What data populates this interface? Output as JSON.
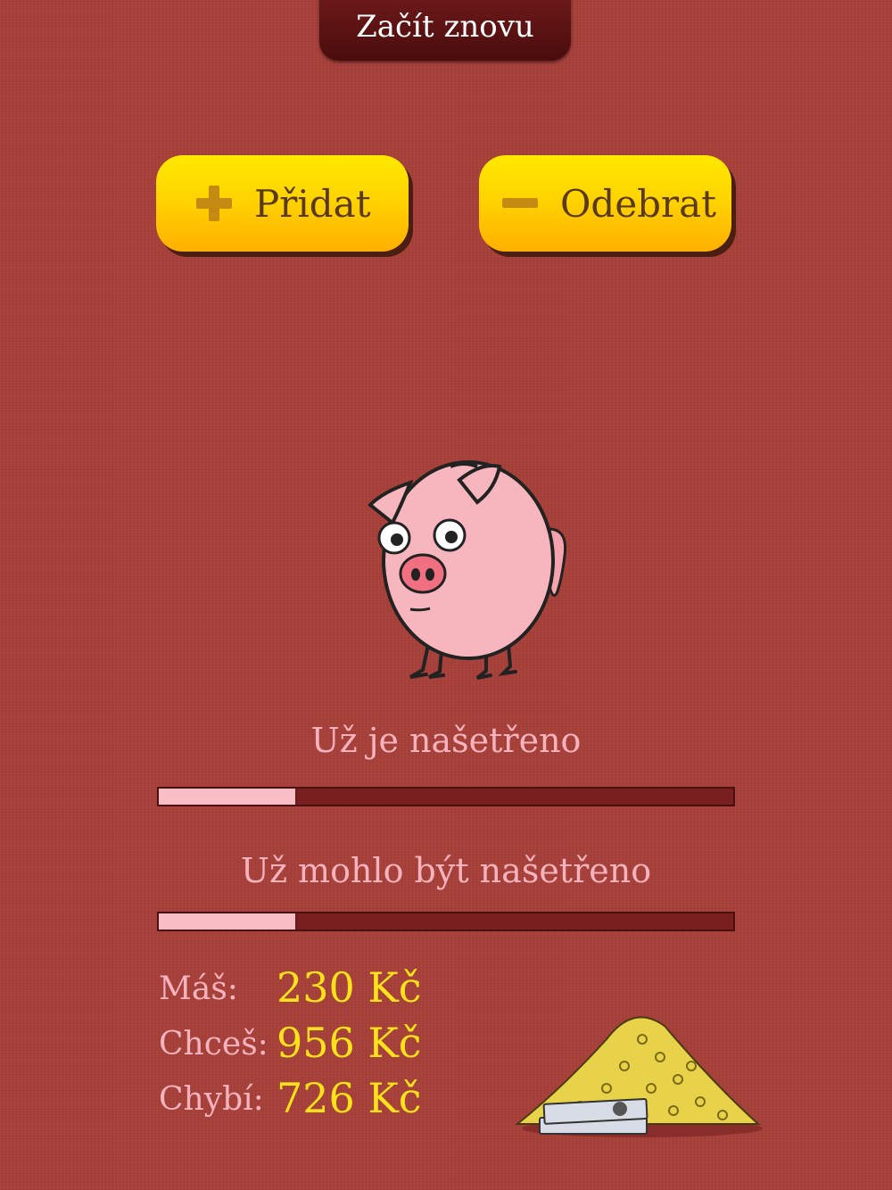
{
  "header": {
    "restart_label": "Začít znovu"
  },
  "actions": {
    "add_label": "Přidat",
    "remove_label": "Odebrat"
  },
  "saved": {
    "label": "Už je našetřeno",
    "progress": 0.24
  },
  "should_be_saved": {
    "label": "Už mohlo být našetřeno",
    "progress": 0.24
  },
  "stats": {
    "have_label": "Máš:",
    "have_value": "230 Kč",
    "want_label": "Chceš:",
    "want_value": "956 Kč",
    "missing_label": "Chybí:",
    "missing_value": "726 Kč"
  },
  "icons": {
    "add": "plus-icon",
    "remove": "minus-icon",
    "mascot": "piggy-bank-illustration",
    "money": "coin-pile-illustration"
  },
  "colors": {
    "background": "#a8403a",
    "button": "#ffd400",
    "accent_text": "#ffe21a",
    "label_text": "#f7b3bd"
  }
}
